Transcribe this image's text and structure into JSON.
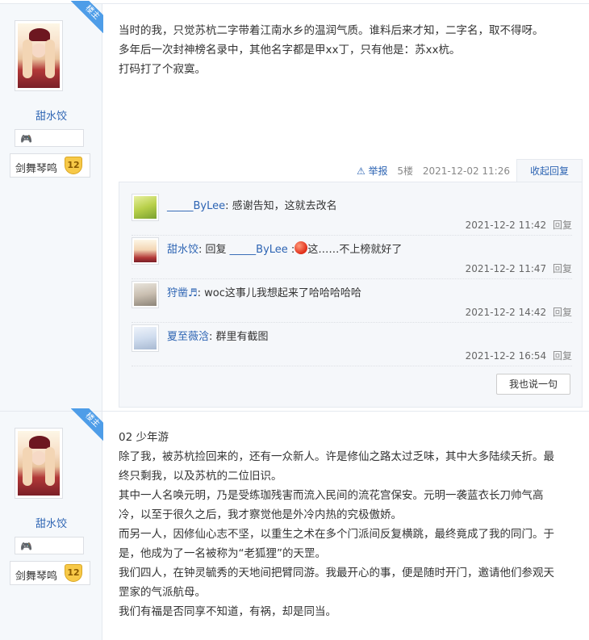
{
  "posts": [
    {
      "badge": "楼主",
      "user": {
        "name": "甜水饺",
        "level_title": "剑舞琴鸣",
        "level": "12"
      },
      "content": [
        "当时的我，只觉苏杭二字带着江南水乡的温润气质。谁料后来才知，二字名，取不得呀。",
        "多年后一次封神榜名录中，其他名字都是甲xx丁，只有他是：苏xx杭。",
        "打码打了个寂寞。"
      ],
      "tail": {
        "report": "举报",
        "floor": "5楼",
        "time": "2021-12-02 11:26",
        "collapse": "收起回复"
      },
      "replies": [
        {
          "name": "_____ByLee",
          "sep": ": ",
          "text": "感谢告知，这就去改名",
          "time": "2021-12-2 11:42",
          "action": "回复"
        },
        {
          "name": "甜水饺",
          "sep": ": ",
          "prefix": "回复 ",
          "target": "_____ByLee",
          "target_sep": " :",
          "text": "这……不上榜就好了",
          "time": "2021-12-2 11:47",
          "action": "回复"
        },
        {
          "name": "狩凿♬",
          "sep": ": ",
          "text": "woc这事儿我想起来了哈哈哈哈哈",
          "time": "2021-12-2 14:42",
          "action": "回复"
        },
        {
          "name": "夏至薇浛",
          "sep": ": ",
          "text": "群里有截图",
          "time": "2021-12-2 16:54",
          "action": "回复"
        }
      ],
      "say_button": "我也说一句"
    },
    {
      "badge": "楼主",
      "user": {
        "name": "甜水饺",
        "level_title": "剑舞琴鸣",
        "level": "12"
      },
      "content": [
        "02 少年游",
        "除了我，被苏杭捡回来的，还有一众新人。许是修仙之路太过乏味，其中大多陆续夭折。最",
        "终只剩我，以及苏杭的二位旧识。",
        "其中一人名唤元明，乃是受练珈残害而流入民间的流花宫保安。元明一袭蓝衣长刀帅气高",
        "冷，以至于很久之后，我才察觉他是外冷内热的究极傲娇。",
        "而另一人，因修仙心志不坚，以重生之术在多个门派间反复横跳，最终竟成了我的同门。于",
        "是，他成为了一名被称为“老狐狸”的天罡。",
        "我们四人，在钟灵毓秀的天地间把臂同游。我最开心的事，便是随时开门，邀请他们参观天",
        "罡家的气派航母。",
        "我们有福是否同享不知道，有祸，却是同当。"
      ]
    }
  ]
}
